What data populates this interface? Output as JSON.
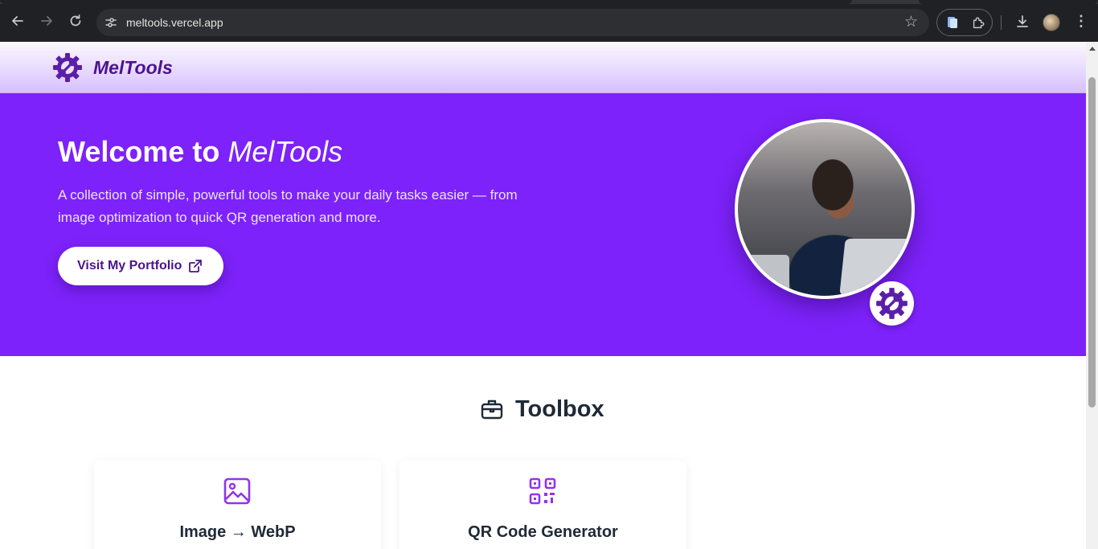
{
  "browser": {
    "url": "meltools.vercel.app",
    "icons": [
      "back-arrow-icon",
      "forward-arrow-icon",
      "reload-icon",
      "site-settings-icon",
      "bookmark-star-icon",
      "extension-icon",
      "puzzle-icon",
      "download-icon",
      "profile-avatar",
      "kebab-menu-icon"
    ]
  },
  "header": {
    "logo_text": "MelTools"
  },
  "hero": {
    "title_prefix": "Welcome to ",
    "title_brand": "MelTools",
    "description": "A collection of simple, powerful tools to make your daily tasks easier — from image optimization to quick QR generation and more.",
    "portfolio_button": "Visit My Portfolio"
  },
  "toolbox": {
    "title": "Toolbox",
    "cards": [
      {
        "title": "Image → WebP",
        "icon": "image-icon"
      },
      {
        "title": "QR Code Generator",
        "icon": "qr-code-icon"
      }
    ]
  },
  "colors": {
    "hero_bg": "#7d22fa",
    "brand_purple": "#4b1390",
    "accent_purple": "#9333ea"
  }
}
